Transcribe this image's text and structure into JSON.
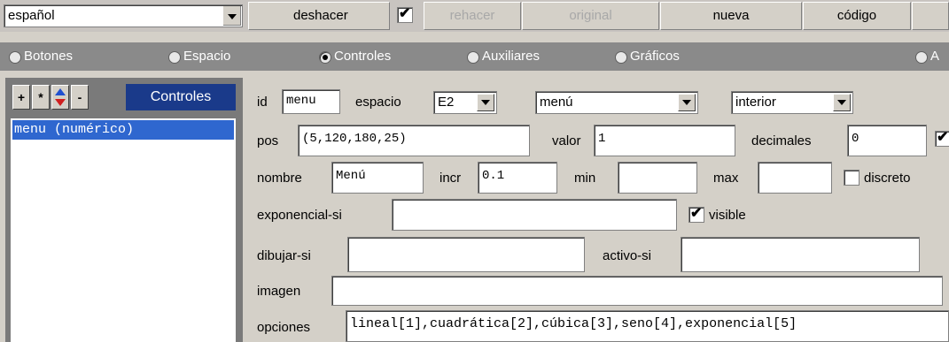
{
  "toolbar": {
    "language_select": "español",
    "undo": "deshacer",
    "undo_checked": true,
    "redo": "rehacer",
    "original": "original",
    "new": "nueva",
    "code": "código"
  },
  "tabs": [
    {
      "label": "Botones",
      "selected": false
    },
    {
      "label": "Espacio",
      "selected": false
    },
    {
      "label": "Controles",
      "selected": true
    },
    {
      "label": "Auxiliares",
      "selected": false
    },
    {
      "label": "Gráficos",
      "selected": false
    },
    {
      "label": "A",
      "selected": false
    }
  ],
  "left_panel": {
    "add": "+",
    "star": "*",
    "remove": "-",
    "title": "Controles",
    "items": [
      "menu (numérico)"
    ]
  },
  "form": {
    "id_label": "id",
    "id_value": "menu",
    "space_label": "espacio",
    "space_value": "E2",
    "type_value": "menú",
    "region_value": "interior",
    "pos_label": "pos",
    "pos_value": "(5,120,180,25)",
    "value_label": "valor",
    "value_value": "1",
    "decimals_label": "decimales",
    "decimals_value": "0",
    "name_label": "nombre",
    "name_value": "Menú",
    "incr_label": "incr",
    "incr_value": "0.1",
    "min_label": "min",
    "min_value": "",
    "max_label": "max",
    "max_value": "",
    "discrete_label": "discreto",
    "discrete_checked": false,
    "exponential_label": "exponencial-si",
    "exponential_value": "",
    "visible_label": "visible",
    "visible_checked": true,
    "draw_label": "dibujar-si",
    "draw_value": "",
    "active_label": "activo-si",
    "active_value": "",
    "image_label": "imagen",
    "image_value": "",
    "options_label": "opciones",
    "options_value": "lineal[1],cuadrática[2],cúbica[3],seno[4],exponencial[5]"
  },
  "colors": {
    "tabbar": "#8a8a8a",
    "list_selection": "#2f67cf",
    "title_bg": "#1a3a8a"
  }
}
